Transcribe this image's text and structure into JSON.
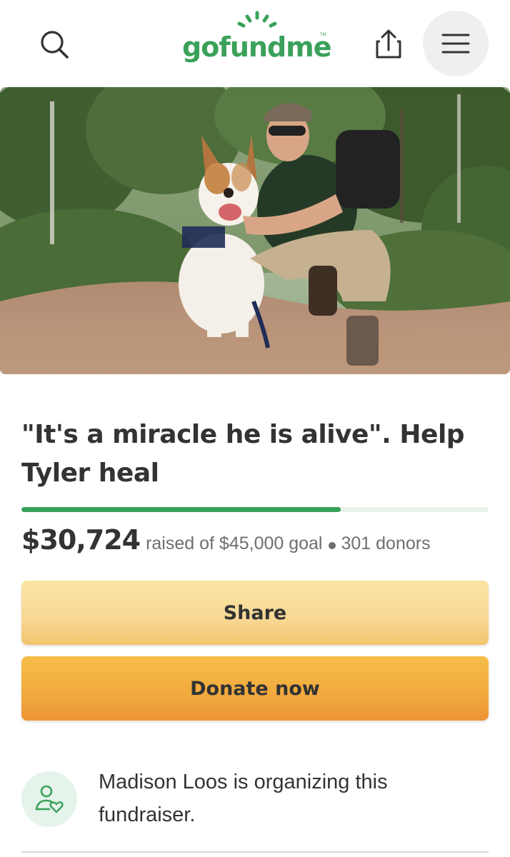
{
  "header": {
    "logo_text": "gofundme",
    "logo_tm": "TM",
    "brand_color": "#3aa15a",
    "search_icon": "search-icon",
    "share_icon": "upload-share-icon",
    "menu_icon": "hamburger-menu-icon"
  },
  "hero": {
    "photo": "man-with-dog-on-hiking-trail"
  },
  "campaign": {
    "title": "\"It's a miracle he is alive\". Help Tyler heal",
    "raised": "$30,724",
    "raised_of_goal": "raised of $45,000 goal",
    "donors": "301 donors",
    "progress_fraction": 0.683
  },
  "actions": {
    "share_label": "Share",
    "donate_label": "Donate now"
  },
  "organizer": {
    "text": "Madison Loos is organizing this fundraiser.",
    "icon": "person-heart-icon"
  },
  "colors": {
    "share_button": "#f8d894",
    "donate_button": "#f1a83d",
    "progress_track": "#e8f3ec"
  }
}
